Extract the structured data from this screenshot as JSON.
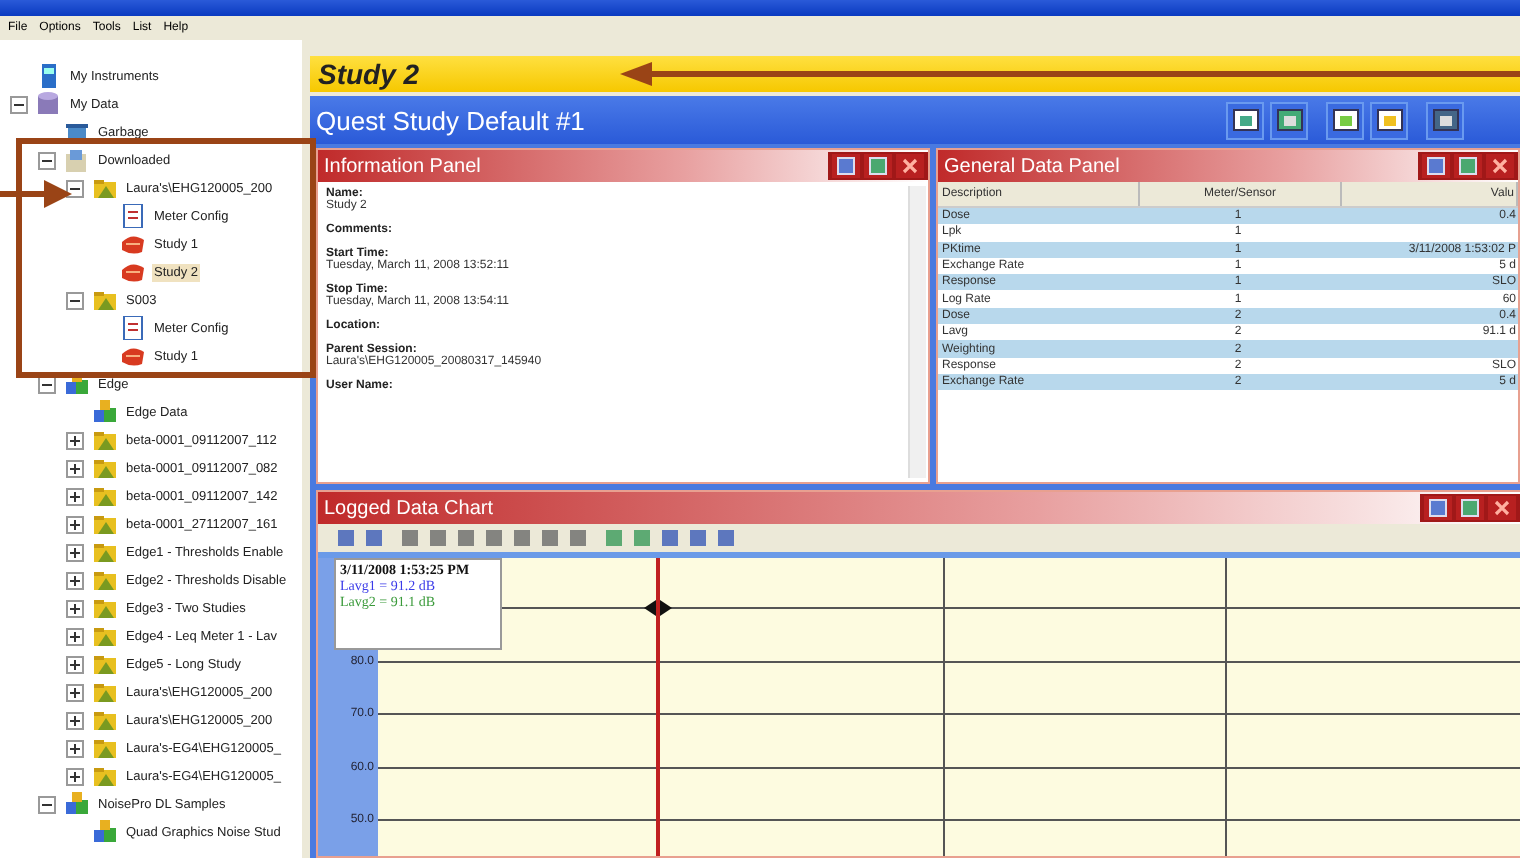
{
  "menu": [
    "File",
    "Options",
    "Tools",
    "List",
    "Help"
  ],
  "tree": [
    {
      "label": "My Instruments",
      "kind": "instrument"
    },
    {
      "label": "My Data",
      "kind": "database",
      "expanded": true,
      "children": [
        {
          "label": "Garbage",
          "kind": "garbage"
        },
        {
          "label": "Downloaded",
          "kind": "download",
          "expanded": true,
          "children": [
            {
              "label": "Laura's\\EHG120005_200",
              "kind": "folder",
              "expanded": true,
              "children": [
                {
                  "label": "Meter Config",
                  "kind": "config",
                  "selected": false
                },
                {
                  "label": "Study 1",
                  "kind": "study",
                  "selected": false
                },
                {
                  "label": "Study 2",
                  "kind": "study",
                  "selected": true
                }
              ]
            },
            {
              "label": "S003",
              "kind": "folder",
              "expanded": true,
              "children": [
                {
                  "label": "Meter Config",
                  "kind": "config",
                  "selected": false
                },
                {
                  "label": "Study 1",
                  "kind": "study",
                  "selected": false
                }
              ]
            }
          ]
        },
        {
          "label": "Edge",
          "kind": "edge",
          "expanded": true,
          "children": [
            {
              "label": "Edge Data",
              "kind": "edge"
            },
            {
              "label": "beta-0001_09112007_112",
              "kind": "folder",
              "expanded": false
            },
            {
              "label": "beta-0001_09112007_082",
              "kind": "folder",
              "expanded": false
            },
            {
              "label": "beta-0001_09112007_142",
              "kind": "folder",
              "expanded": false
            },
            {
              "label": "beta-0001_27112007_161",
              "kind": "folder",
              "expanded": false
            },
            {
              "label": "Edge1 - Thresholds Enable",
              "kind": "folder",
              "expanded": false
            },
            {
              "label": "Edge2 - Thresholds Disable",
              "kind": "folder",
              "expanded": false
            },
            {
              "label": "Edge3 - Two Studies",
              "kind": "folder",
              "expanded": false
            },
            {
              "label": "Edge4 - Leq Meter 1 - Lav",
              "kind": "folder",
              "expanded": false
            },
            {
              "label": "Edge5 - Long Study",
              "kind": "folder",
              "expanded": false
            },
            {
              "label": "Laura's\\EHG120005_200",
              "kind": "folder",
              "expanded": false
            },
            {
              "label": "Laura's\\EHG120005_200",
              "kind": "folder",
              "expanded": false
            },
            {
              "label": "Laura's-EG4\\EHG120005_",
              "kind": "folder",
              "expanded": false
            },
            {
              "label": "Laura's-EG4\\EHG120005_",
              "kind": "folder",
              "expanded": false
            }
          ]
        },
        {
          "label": "NoisePro DL Samples",
          "kind": "edge",
          "expanded": true,
          "children": [
            {
              "label": "Quad Graphics Noise Stud",
              "kind": "edge"
            }
          ]
        }
      ]
    }
  ],
  "study_title": "Study 2",
  "header": {
    "title": "Quest Study Default #1"
  },
  "info_panel": {
    "title": "Information Panel",
    "fields": [
      {
        "label": "Name:",
        "value": "Study 2"
      },
      {
        "label": "Comments:"
      },
      {
        "label": "Start Time:",
        "value": "Tuesday, March 11, 2008 13:52:11"
      },
      {
        "label": "Stop Time:",
        "value": "Tuesday, March 11, 2008 13:54:11"
      },
      {
        "label": "Location:"
      },
      {
        "label": "Parent Session:",
        "value": "Laura's\\EHG120005_20080317_145940"
      },
      {
        "label": "User Name:"
      }
    ]
  },
  "data_panel": {
    "title": "General Data Panel",
    "columns": [
      "Description",
      "Meter/Sensor",
      "Valu"
    ],
    "rows": [
      {
        "description": "Dose",
        "meter": "1",
        "value": "0.4"
      },
      {
        "description": "Lpk",
        "meter": "1"
      },
      {
        "description": "PKtime",
        "meter": "1",
        "value": "3/11/2008 1:53:02 P"
      },
      {
        "description": "Exchange Rate",
        "meter": "1",
        "value": "5 d"
      },
      {
        "description": "Response",
        "meter": "1",
        "value": "SLO"
      },
      {
        "description": "Log Rate",
        "meter": "1",
        "value": "60"
      },
      {
        "description": "Dose",
        "meter": "2",
        "value": "0.4"
      },
      {
        "description": "Lavg",
        "meter": "2",
        "value": "91.1 d"
      },
      {
        "description": "Weighting",
        "meter": "2"
      },
      {
        "description": "Response",
        "meter": "2",
        "value": "SLO"
      },
      {
        "description": "Exchange Rate",
        "meter": "2",
        "value": "5 d"
      }
    ]
  },
  "chart_panel": {
    "title": "Logged Data Chart",
    "legend": {
      "time": "3/11/2008 1:53:25 PM",
      "entries": [
        {
          "text": "Lavg1 = 91.2 dB",
          "color": "#3a3ae8"
        },
        {
          "text": "Lavg2 = 91.1 dB",
          "color": "#3a9a3a"
        }
      ]
    },
    "y_ticks": [
      "80.0",
      "70.0",
      "60.0",
      "50.0"
    ]
  }
}
